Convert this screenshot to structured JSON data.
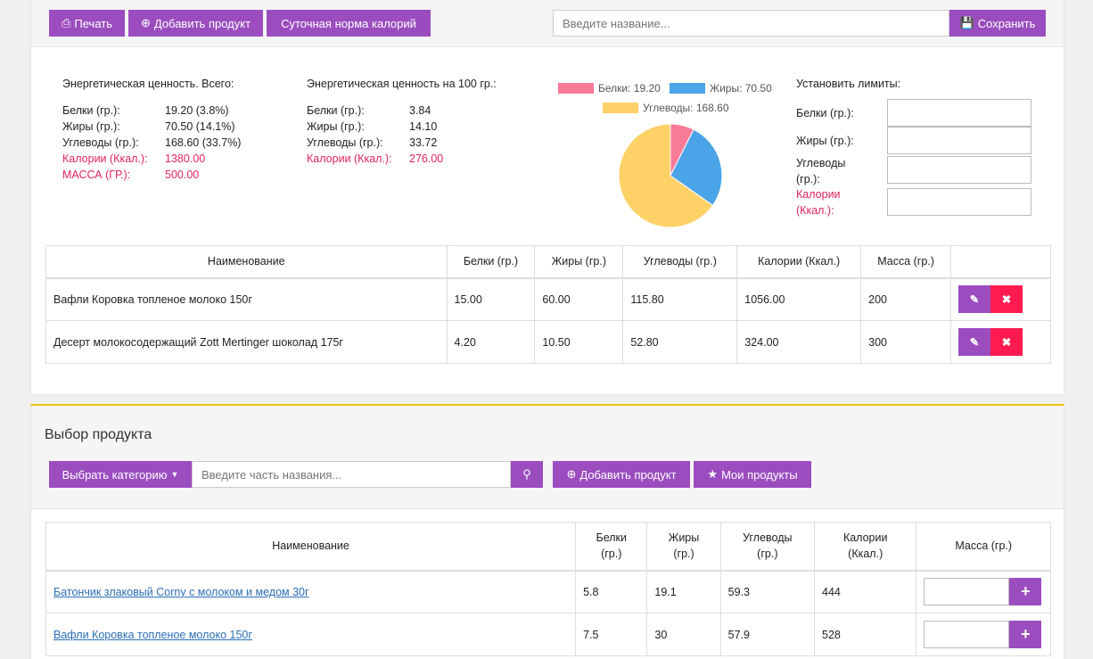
{
  "toolbar": {
    "print_label": "Печать",
    "add_product_label": "Добавить продукт",
    "daily_norm_label": "Суточная норма калорий",
    "name_placeholder": "Введите название...",
    "save_label": "Сохранить"
  },
  "totals": {
    "title": "Энергетическая ценность. Всего:",
    "rows": [
      {
        "k": "Белки (гр.):",
        "v": "19.20 (3.8%)"
      },
      {
        "k": "Жиры (гр.):",
        "v": "70.50 (14.1%)"
      },
      {
        "k": "Углеводы (гр.):",
        "v": "168.60 (33.7%)"
      },
      {
        "k": "Калории (Ккал.):",
        "v": "1380.00"
      },
      {
        "k": "МАССА (ГР.):",
        "v": "500.00"
      }
    ]
  },
  "per100": {
    "title": "Энергетическая ценность на 100 гр.:",
    "rows": [
      {
        "k": "Белки (гр.):",
        "v": "3.84"
      },
      {
        "k": "Жиры (гр.):",
        "v": "14.10"
      },
      {
        "k": "Углеводы (гр.):",
        "v": "33.72"
      },
      {
        "k": "Калории (Ккал.):",
        "v": "276.00"
      }
    ]
  },
  "chart_data": {
    "type": "pie",
    "series": [
      {
        "name": "Белки: 19.20",
        "value": 19.2,
        "color": "#f77a96"
      },
      {
        "name": "Жиры: 70.50",
        "value": 70.5,
        "color": "#4ba3e8"
      },
      {
        "name": "Углеводы: 168.60",
        "value": 168.6,
        "color": "#ffd166"
      }
    ],
    "legend_position": "top"
  },
  "limits": {
    "title": "Установить лимиты:",
    "protein": "Белки (гр.):",
    "fat": "Жиры (гр.):",
    "carbs_1": "Углеводы",
    "carbs_2": "(гр.):",
    "cal_1": "Калории",
    "cal_2": "(Ккал.):"
  },
  "meal_table": {
    "headers": [
      "Наименование",
      "Белки (гр.)",
      "Жиры (гр.)",
      "Углеводы (гр.)",
      "Калории (Ккал.)",
      "Масса (гр.)"
    ],
    "rows": [
      {
        "name": "Вафли Коровка топленое молоко 150г",
        "protein": "15.00",
        "fat": "60.00",
        "carbs": "115.80",
        "cal": "1056.00",
        "mass": "200"
      },
      {
        "name": "Десерт молокосодержащий Zott Mertinger шоколад 175г",
        "protein": "4.20",
        "fat": "10.50",
        "carbs": "52.80",
        "cal": "324.00",
        "mass": "300"
      }
    ]
  },
  "selection": {
    "title": "Выбор продукта",
    "category_label": "Выбрать категорию",
    "search_placeholder": "Введите часть названия...",
    "add_product_label": "Добавить продукт",
    "my_products_label": "Мои продукты"
  },
  "product_table": {
    "headers": {
      "name": "Наименование",
      "protein_1": "Белки",
      "protein_2": "(гр.)",
      "fat_1": "Жиры",
      "fat_2": "(гр.)",
      "carbs_1": "Углеводы",
      "carbs_2": "(гр.)",
      "cal_1": "Калории",
      "cal_2": "(Ккал.)",
      "mass": "Масса (гр.)"
    },
    "rows": [
      {
        "name": "Батончик злаковый Corny с молоком и медом 30г",
        "protein": "5.8",
        "fat": "19.1",
        "carbs": "59.3",
        "cal": "444"
      },
      {
        "name": "Вафли Коровка топленое молоко 150г",
        "protein": "7.5",
        "fat": "30",
        "carbs": "57.9",
        "cal": "528"
      }
    ]
  },
  "colors": {
    "accent": "#9b4dbf",
    "danger": "#ff1a4f",
    "highlight": "#e0245e",
    "border_top": "#f2c500"
  }
}
